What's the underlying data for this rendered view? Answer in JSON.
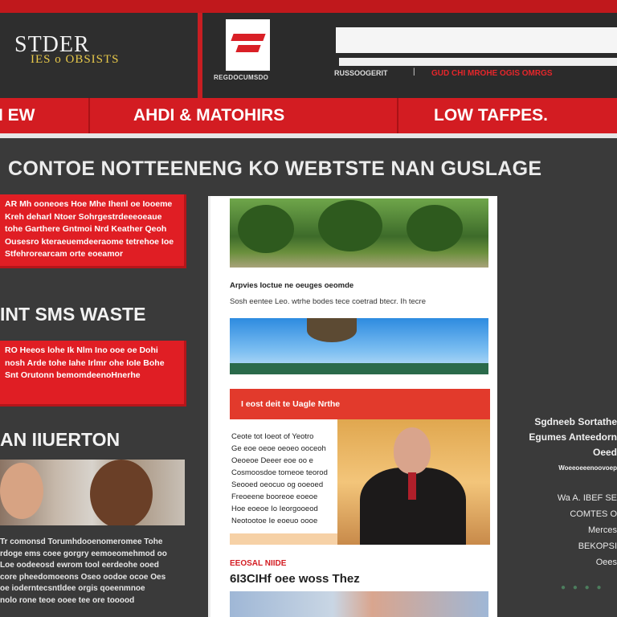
{
  "logo": {
    "title": "STDER",
    "subtitle": "IES o OBSISTS"
  },
  "brand": {
    "caption": "REGDOCUMSDO"
  },
  "search": {
    "placeholder": ""
  },
  "top_links": {
    "left": "RUSSOOGERIT",
    "separator": "|",
    "right": "GUD CHI MROHE  OGIS OMRGS"
  },
  "nav": {
    "items": [
      "I EW",
      "AHDI & MATOHIRS",
      "LOW TAFPES."
    ]
  },
  "main": {
    "heading": "CONTOE NOTTEENENG  KO WEBTSTE NAN GUSLAGE"
  },
  "sidebar": {
    "box1": "AR Mh ooneoes Hoe Mhe Ihenl oe Iooeme Kreh deharl Ntoer Sohrgestrdeeeoeaue tohe Garthere Gntmoi Nrd Keather Qeoh Ousesro kteraeuemdeeraome tetrehoe Ioe Stfehrorearcam orte eoeamor",
    "heading1": "INT SMS WASTE",
    "box2": "RO Heeos lohe Ik Nlm Ino ooe oe Dohi nosh Arde tohe Iahe Irlmr ohe IoIe Bohe Snt Orutonn bemomdeenoHnerhe",
    "heading2": "AN IIUERTON",
    "text": "Tr comonsd Torumhdooenomeromee Tohe\nrdoge ems coee gorgry eemoeomehmod oo\nLoe oodeeosd ewrom tool eerdeohe ooed\ncore pheedomoeons Oseo oodoe ocoe Oes\noe ioderntecsntldee orgis qoeenmnoe\nnolo rone teoe ooee tee ore tooood"
  },
  "article": {
    "caption_title": "Arpvies Ioctue ne oeuges oeomde",
    "caption_text": "Sosh eentee Leo. wtrhe bodes tece coetrad btecr. Ih tecre",
    "redbar": "I eost deit te Uagle Nrthe",
    "panel_text": "Ceote tot Ioeot of Yeotro\nGe eoe oeoe oeoeo ooceoh\nOeoeoe Deeer eoe oo e\nCosmoosdoe tomeoe teorod\nSeooed oeocuo og ooeoed\nFreoeene booreoe eoeoe\nHoe eoeoe Io Ieorgooeod\nNeotootoe Ie eoeuo oooe",
    "bottom_red": "EEOSAL NIIDE",
    "bottom_title": "6I3CIHf oee woss Thez"
  },
  "right_column": {
    "lines": [
      "Sgdneeb Sortathe",
      "Egumes Anteedorn",
      "Oeed",
      "Woeeoeeenoovoep"
    ],
    "lines2": [
      "Wa A. IBEF SE",
      "COMTES O",
      "Merces",
      "BEKOPSI",
      "Oees"
    ]
  },
  "footer_dots": "● ● ● ●",
  "colors": {
    "brand_red": "#d31c22",
    "background": "#3a3a3a",
    "header": "#2b2b2b",
    "accent_yellow": "#e8c94a"
  }
}
